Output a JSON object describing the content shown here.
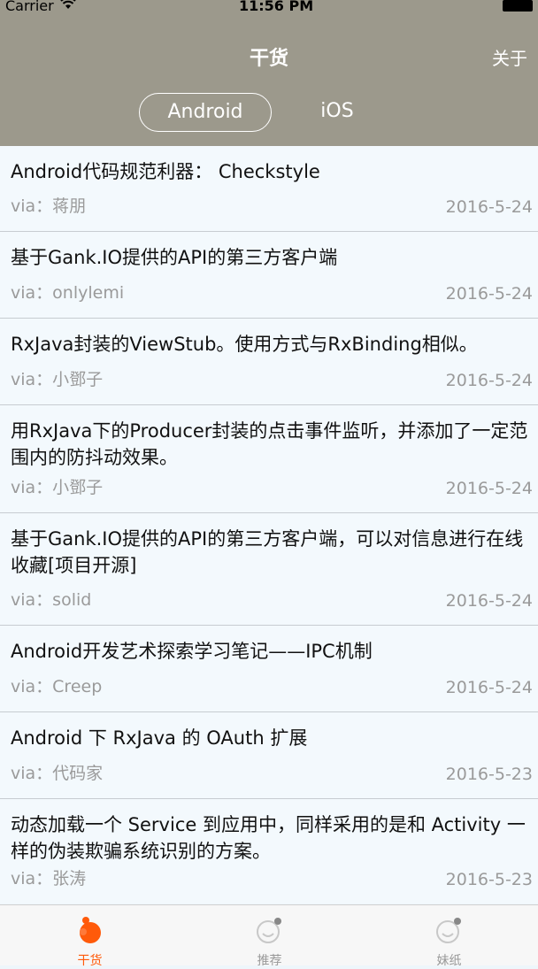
{
  "status_bar": {
    "carrier": "Carrier",
    "time": "11:56 PM"
  },
  "nav": {
    "title": "干货",
    "about": "关于"
  },
  "segments": {
    "selected": "Android",
    "other": "iOS"
  },
  "items": [
    {
      "title": "Android代码规范利器： Checkstyle",
      "via": "via：蒋朋",
      "date": "2016-5-24"
    },
    {
      "title": "基于Gank.IO提供的API的第三方客户端",
      "via": "via：onlylemi",
      "date": "2016-5-24"
    },
    {
      "title": "RxJava封装的ViewStub。使用方式与RxBinding相似。",
      "via": "via：小鄧子",
      "date": "2016-5-24"
    },
    {
      "title": "用RxJava下的Producer封装的点击事件监听，并添加了一定范围内的防抖动效果。",
      "via": "via：小鄧子",
      "date": "2016-5-24"
    },
    {
      "title": "基于Gank.IO提供的API的第三方客户端，可以对信息进行在线收藏[项目开源]",
      "via": "via：solid",
      "date": "2016-5-24"
    },
    {
      "title": "Android开发艺术探索学习笔记——IPC机制",
      "via": "via：Creep",
      "date": "2016-5-24"
    },
    {
      "title": "Android 下 RxJava 的 OAuth 扩展",
      "via": "via：代码家",
      "date": "2016-5-23"
    },
    {
      "title": "动态加载一个 Service 到应用中，同样采用的是和 Activity 一样的伪装欺骗系统识别的方案。",
      "via": "via：张涛",
      "date": "2016-5-23"
    }
  ],
  "tabs": [
    {
      "label": "干货",
      "icon": "dry-goods-icon"
    },
    {
      "label": "推荐",
      "icon": "recommend-icon"
    },
    {
      "label": "妹纸",
      "icon": "girls-icon"
    }
  ],
  "colors": {
    "nav_bg": "#9c998c",
    "accent": "#ff5a0a",
    "list_bg": "#f3f9fd"
  }
}
